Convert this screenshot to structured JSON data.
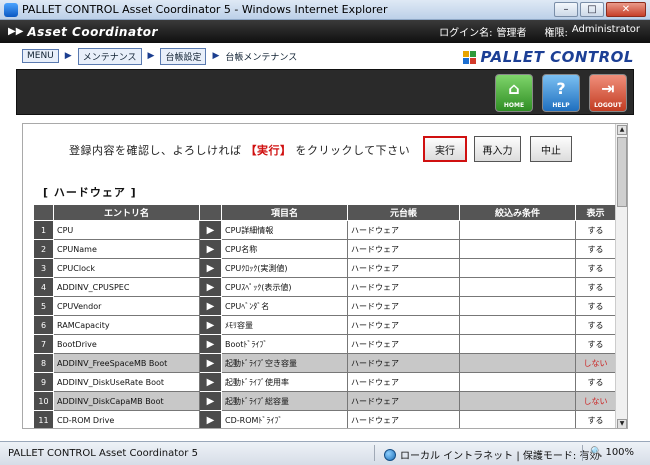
{
  "window": {
    "title": "PALLET CONTROL Asset Coordinator 5 - Windows Internet Explorer",
    "btn_minimize": "–",
    "btn_maximize": "□",
    "btn_close": "✕"
  },
  "header": {
    "logo_arrows": "▶▶",
    "app_name": "Asset Coordinator",
    "login_label": "ログイン名:",
    "login_value": "管理者",
    "role_label": "権限:",
    "role_value": "Administrator"
  },
  "breadcrumb": {
    "menu": "MENU",
    "maintenance": "メンテナンス",
    "ledger_settings": "台帳設定",
    "current": "台帳メンテナンス",
    "arrow": "▶"
  },
  "brand": {
    "name": "PALLET CONTROL",
    "colors": [
      "#e8a400",
      "#2f9a3a",
      "#1c6fd1",
      "#d33a2a"
    ]
  },
  "toolbar": {
    "home_label": "HOME",
    "home_glyph": "⌂",
    "help_label": "HELP",
    "help_glyph": "?",
    "logout_label": "LOGOUT",
    "logout_glyph": "⇥"
  },
  "confirm": {
    "msg_before": "登録内容を確認し、よろしければ",
    "msg_highlight": "【実行】",
    "msg_after": "をクリックして下さい",
    "execute": "実行",
    "reinput": "再入力",
    "cancel": "中止"
  },
  "section": {
    "title": "[ ハードウェア ]"
  },
  "table": {
    "headers": [
      "",
      "エントリ名",
      "",
      "項目名",
      "元台帳",
      "絞込み条件",
      "表示"
    ],
    "go_glyph": "▶",
    "rows": [
      {
        "no": "1",
        "entry": "CPU",
        "item": "CPU詳細情報",
        "ledger": "ハードウェア",
        "filter": "",
        "display": "する",
        "grey": false
      },
      {
        "no": "2",
        "entry": "CPUName",
        "item": "CPU名称",
        "ledger": "ハードウェア",
        "filter": "",
        "display": "する",
        "grey": false
      },
      {
        "no": "3",
        "entry": "CPUClock",
        "item": "CPUｸﾛｯｸ(実測値)",
        "ledger": "ハードウェア",
        "filter": "",
        "display": "する",
        "grey": false
      },
      {
        "no": "4",
        "entry": "ADDINV_CPUSPEC",
        "item": "CPUｽﾍﾟｯｸ(表示値)",
        "ledger": "ハードウェア",
        "filter": "",
        "display": "する",
        "grey": false
      },
      {
        "no": "5",
        "entry": "CPUVendor",
        "item": "CPUﾍﾞﾝﾀﾞ名",
        "ledger": "ハードウェア",
        "filter": "",
        "display": "する",
        "grey": false
      },
      {
        "no": "6",
        "entry": "RAMCapacity",
        "item": "ﾒﾓﾘ容量",
        "ledger": "ハードウェア",
        "filter": "",
        "display": "する",
        "grey": false
      },
      {
        "no": "7",
        "entry": "BootDrive",
        "item": "Bootﾄﾞﾗｲﾌﾞ",
        "ledger": "ハードウェア",
        "filter": "",
        "display": "する",
        "grey": false
      },
      {
        "no": "8",
        "entry": "ADDINV_FreeSpaceMB Boot",
        "item": "起動ﾄﾞﾗｲﾌﾞ空き容量",
        "ledger": "ハードウェア",
        "filter": "",
        "display": "しない",
        "grey": true
      },
      {
        "no": "9",
        "entry": "ADDINV_DiskUseRate Boot",
        "item": "起動ﾄﾞﾗｲﾌﾞ使用率",
        "ledger": "ハードウェア",
        "filter": "",
        "display": "する",
        "grey": false
      },
      {
        "no": "10",
        "entry": "ADDINV_DiskCapaMB Boot",
        "item": "起動ﾄﾞﾗｲﾌﾞ総容量",
        "ledger": "ハードウェア",
        "filter": "",
        "display": "しない",
        "grey": true
      },
      {
        "no": "11",
        "entry": "CD-ROM Drive",
        "item": "CD-ROMﾄﾞﾗｲﾌﾞ",
        "ledger": "ハードウェア",
        "filter": "",
        "display": "する",
        "grey": false
      }
    ]
  },
  "status": {
    "left": "PALLET CONTROL Asset Coordinator 5",
    "zone": "ローカル イントラネット | 保護モード: 有効",
    "zoom": "100%"
  }
}
